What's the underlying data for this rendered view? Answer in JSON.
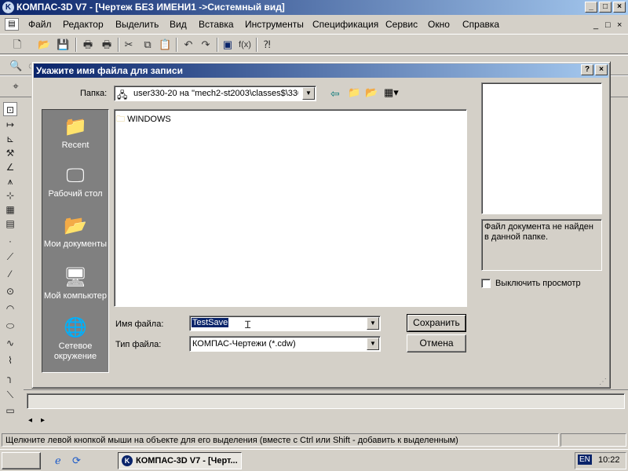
{
  "app": {
    "title": "КОМПАС-3D V7 - [Чертеж БЕЗ ИМЕНИ1 ->Системный вид]",
    "icon": "K"
  },
  "window_controls": {
    "minimize": "_",
    "maximize": "□",
    "close": "×"
  },
  "menu": {
    "items": [
      "Файл",
      "Редактор",
      "Выделить",
      "Вид",
      "Вставка",
      "Инструменты",
      "Спецификация",
      "Сервис",
      "Окно",
      "Справка"
    ]
  },
  "dialog": {
    "title": "Укажите имя файла для записи",
    "help_button": "?",
    "close_button": "×",
    "folder_label": "Папка:",
    "folder_value": "user330-20 на ''mech2-st2003\\classes$\\330'",
    "files": [
      {
        "name": "WINDOWS",
        "type": "folder"
      }
    ],
    "places": [
      {
        "label": "Recent",
        "icon": "folder-icon"
      },
      {
        "label": "Рабочий стол",
        "icon": "desktop-icon"
      },
      {
        "label": "Мои документы",
        "icon": "my-documents-icon"
      },
      {
        "label": "Мой компьютер",
        "icon": "my-computer-icon"
      },
      {
        "label": "Сетевое окружение",
        "icon": "network-icon"
      }
    ],
    "filename_label": "Имя файла:",
    "filename_value": "TestSave",
    "filetype_label": "Тип файла:",
    "filetype_value": "КОМПАС-Чертежи (*.cdw)",
    "save_button": "Сохранить",
    "cancel_button": "Отмена",
    "preview_message": "Файл документа не найден в данной папке.",
    "disable_preview_label": "Выключить просмотр",
    "disable_preview_checked": false
  },
  "status": {
    "text": "Щелкните левой кнопкой мыши на объекте для его выделения (вместе с Ctrl или Shift - добавить к выделенным)"
  },
  "taskbar": {
    "active_task": "КОМПАС-3D V7 - [Черт...",
    "language": "EN",
    "clock": "10:22"
  },
  "colors": {
    "titlebar_start": "#0a246a",
    "titlebar_end": "#a6caf0",
    "face": "#d4d0c8",
    "selection": "#0a246a"
  }
}
